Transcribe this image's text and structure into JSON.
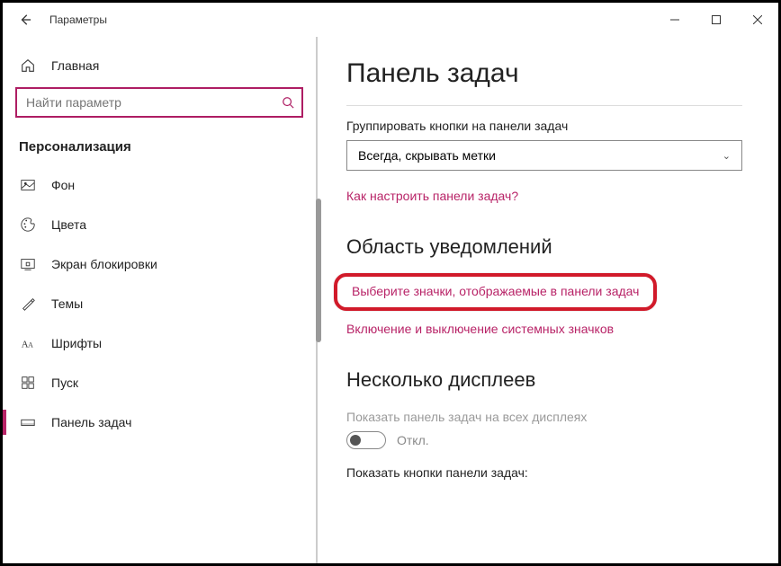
{
  "titlebar": {
    "app_title": "Параметры"
  },
  "sidebar": {
    "home": "Главная",
    "search_placeholder": "Найти параметр",
    "category": "Персонализация",
    "items": [
      {
        "icon": "picture",
        "label": "Фон"
      },
      {
        "icon": "palette",
        "label": "Цвета"
      },
      {
        "icon": "lockscreen",
        "label": "Экран блокировки"
      },
      {
        "icon": "themes",
        "label": "Темы"
      },
      {
        "icon": "fonts",
        "label": "Шрифты"
      },
      {
        "icon": "start",
        "label": "Пуск"
      },
      {
        "icon": "taskbar",
        "label": "Панель задач"
      }
    ],
    "active_index": 6
  },
  "main": {
    "page_title": "Панель задач",
    "group_label": "Группировать кнопки на панели задач",
    "group_value": "Всегда, скрывать метки",
    "help_link": "Как настроить панели задач?",
    "section_notif": "Область уведомлений",
    "link_icons": "Выберите значки, отображаемые в панели задач",
    "link_sys_icons": "Включение и выключение системных значков",
    "section_multi": "Несколько дисплеев",
    "multi_label": "Показать панель задач на всех дисплеях",
    "toggle_state": "Откл.",
    "show_buttons_label": "Показать кнопки панели задач:"
  }
}
